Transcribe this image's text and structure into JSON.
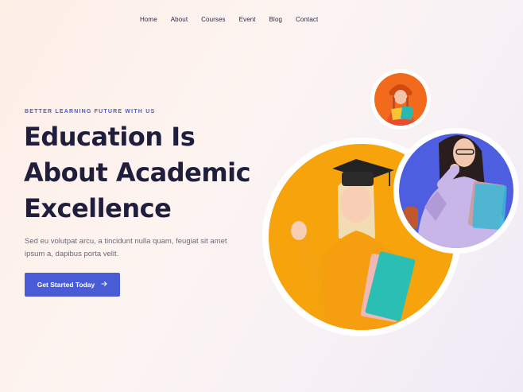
{
  "nav": {
    "items": [
      "Home",
      "About",
      "Courses",
      "Event",
      "Blog",
      "Contact"
    ]
  },
  "hero": {
    "eyebrow": "BETTER LEARNING FUTURE WITH US",
    "title_lines": [
      "Education Is",
      "About Academic",
      "Excellence"
    ],
    "description": "Sed eu volutpat arcu, a tincidunt nulla quam, feugiat sit amet ipsum a, dapibus porta velit.",
    "cta_label": "Get Started Today",
    "cta_icon": "arrow-right-icon"
  },
  "colors": {
    "accent": "#4a5bd6",
    "heading": "#1f1f3d",
    "orange": "#f7a40c",
    "orange_small": "#f26a1b",
    "blue_circle": "#4d5fe0"
  }
}
